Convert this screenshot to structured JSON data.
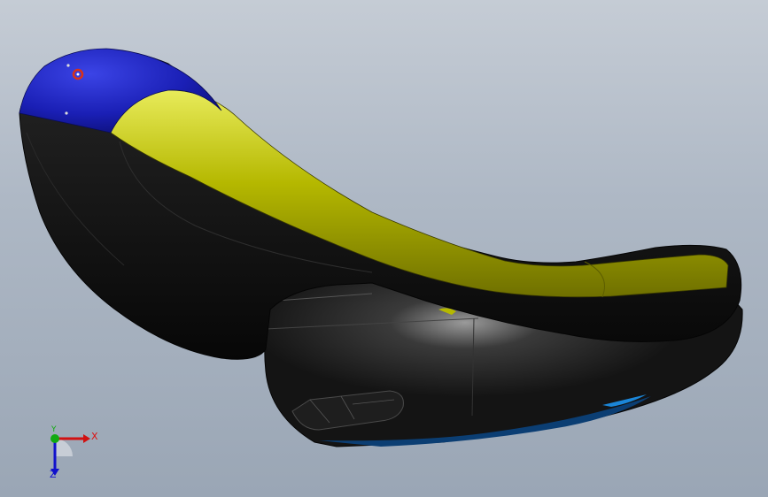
{
  "viewport": {
    "background_top": "#c5ccd5",
    "background_bottom": "#9aa6b5"
  },
  "model": {
    "body_color": "#111111",
    "cap_color": "#1a1fb5",
    "band_color": "#b5b800",
    "accent_marker_color": "#d8321a",
    "underside_highlight_color": "#1b86d8"
  },
  "triad": {
    "x_label": "X",
    "y_label": "Y",
    "z_label": "Z",
    "x_color": "#d11111",
    "y_color": "#11aa11",
    "z_color": "#1111cc",
    "icon": "coordinate-triad-icon"
  }
}
